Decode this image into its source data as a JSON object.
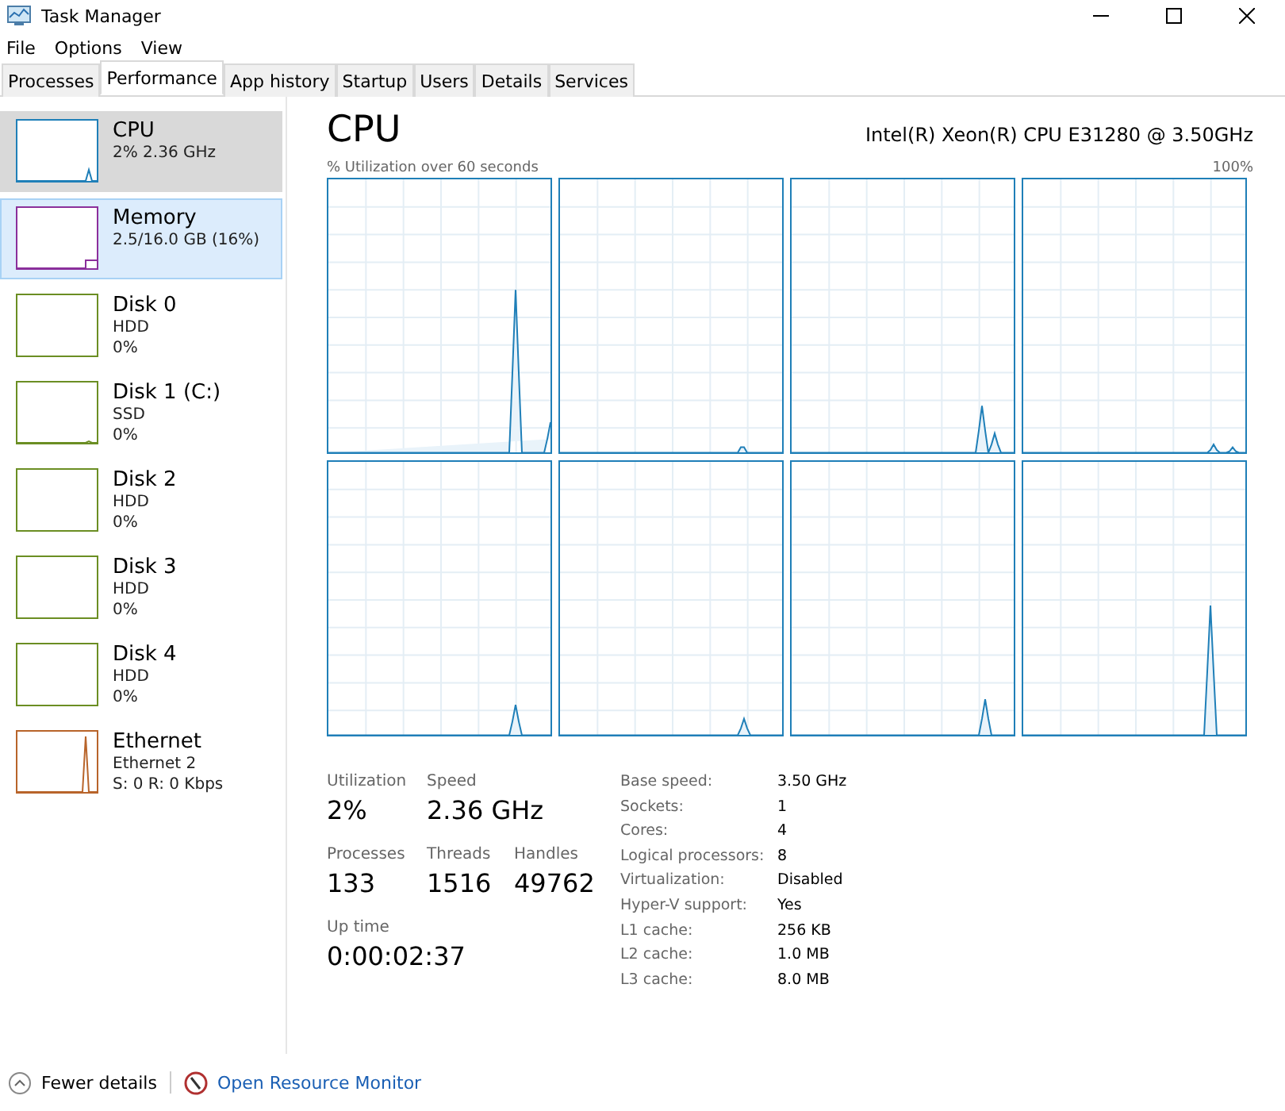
{
  "window": {
    "title": "Task Manager"
  },
  "menu": [
    "File",
    "Options",
    "View"
  ],
  "tabs": [
    {
      "label": "Processes",
      "selected": false
    },
    {
      "label": "Performance",
      "selected": true
    },
    {
      "label": "App history",
      "selected": false
    },
    {
      "label": "Startup",
      "selected": false
    },
    {
      "label": "Users",
      "selected": false
    },
    {
      "label": "Details",
      "selected": false
    },
    {
      "label": "Services",
      "selected": false
    }
  ],
  "sidebar": {
    "items": [
      {
        "title": "CPU",
        "lines": [
          "2% 2.36 GHz"
        ],
        "color": "#1f7fb8",
        "selected": true,
        "hovered": false
      },
      {
        "title": "Memory",
        "lines": [
          "2.5/16.0 GB (16%)"
        ],
        "color": "#8b2f9b",
        "selected": false,
        "hovered": true
      },
      {
        "title": "Disk 0",
        "lines": [
          "HDD",
          "0%"
        ],
        "color": "#6b8e23",
        "selected": false,
        "hovered": false
      },
      {
        "title": "Disk 1 (C:)",
        "lines": [
          "SSD",
          "0%"
        ],
        "color": "#6b8e23",
        "selected": false,
        "hovered": false
      },
      {
        "title": "Disk 2",
        "lines": [
          "HDD",
          "0%"
        ],
        "color": "#6b8e23",
        "selected": false,
        "hovered": false
      },
      {
        "title": "Disk 3",
        "lines": [
          "HDD",
          "0%"
        ],
        "color": "#6b8e23",
        "selected": false,
        "hovered": false
      },
      {
        "title": "Disk 4",
        "lines": [
          "HDD",
          "0%"
        ],
        "color": "#6b8e23",
        "selected": false,
        "hovered": false
      },
      {
        "title": "Ethernet",
        "lines": [
          "Ethernet 2",
          "S: 0 R: 0 Kbps"
        ],
        "color": "#b8642a",
        "selected": false,
        "hovered": false
      }
    ]
  },
  "panel": {
    "title": "CPU",
    "model": "Intel(R) Xeon(R) CPU E31280 @ 3.50GHz",
    "graph_caption": "% Utilization over 60 seconds",
    "graph_max": "100%",
    "stats": [
      {
        "label": "Utilization",
        "value": "2%"
      },
      {
        "label": "Speed",
        "value": "2.36 GHz"
      },
      {
        "label": "Processes",
        "value": "133"
      },
      {
        "label": "Threads",
        "value": "1516"
      },
      {
        "label": "Handles",
        "value": "49762"
      },
      {
        "label": "Up time",
        "value": "0:00:02:37"
      }
    ],
    "details": [
      {
        "label": "Base speed:",
        "value": "3.50 GHz"
      },
      {
        "label": "Sockets:",
        "value": "1"
      },
      {
        "label": "Cores:",
        "value": "4"
      },
      {
        "label": "Logical processors:",
        "value": "8"
      },
      {
        "label": "Virtualization:",
        "value": "Disabled"
      },
      {
        "label": "Hyper-V support:",
        "value": "Yes"
      },
      {
        "label": "L1 cache:",
        "value": "256 KB"
      },
      {
        "label": "L2 cache:",
        "value": "1.0 MB"
      },
      {
        "label": "L3 cache:",
        "value": "8.0 MB"
      }
    ]
  },
  "footer": {
    "fewer": "Fewer details",
    "monitor": "Open Resource Monitor"
  }
}
